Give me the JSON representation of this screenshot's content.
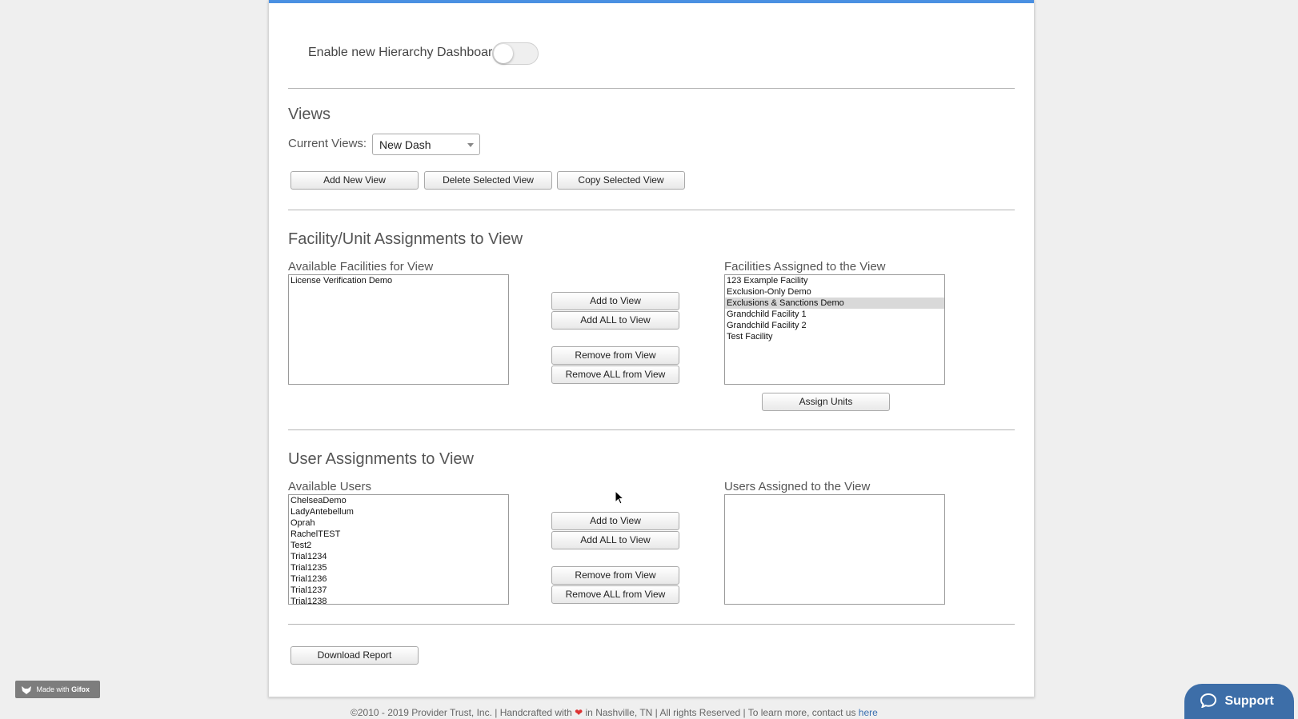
{
  "toggle": {
    "label": "Enable new Hierarchy Dashboard",
    "on": false
  },
  "views": {
    "heading": "Views",
    "current_label": "Current Views:",
    "selected": "New Dash",
    "buttons": {
      "add": "Add New View",
      "delete": "Delete Selected View",
      "copy": "Copy Selected View"
    }
  },
  "facility": {
    "heading": "Facility/Unit Assignments to View",
    "available_label": "Available Facilities for View",
    "assigned_label": "Facilities Assigned to the View",
    "available": [
      "License Verification Demo"
    ],
    "assigned": [
      "123 Example Facility",
      "Exclusion-Only Demo",
      "Exclusions & Sanctions Demo",
      "Grandchild Facility 1",
      "Grandchild Facility 2",
      "Test Facility"
    ],
    "assigned_selected": "Exclusions & Sanctions Demo",
    "buttons": {
      "add": "Add to View",
      "add_all": "Add ALL to View",
      "remove": "Remove from View",
      "remove_all": "Remove ALL from View",
      "assign_units": "Assign Units"
    }
  },
  "users": {
    "heading": "User Assignments to View",
    "available_label": "Available Users",
    "assigned_label": "Users Assigned to the View",
    "available": [
      "ChelseaDemo",
      "LadyAntebellum",
      "Oprah",
      "RachelTEST",
      "Test2",
      "Trial1234",
      "Trial1235",
      "Trial1236",
      "Trial1237",
      "Trial1238"
    ],
    "assigned": [],
    "buttons": {
      "add": "Add to View",
      "add_all": "Add ALL to View",
      "remove": "Remove from View",
      "remove_all": "Remove ALL from View"
    }
  },
  "download_label": "Download Report",
  "gifox": {
    "prefix": "Made with",
    "brand": "Gifox"
  },
  "support_label": "Support",
  "footer": {
    "left": "©2010 - 2019 Provider Trust, Inc.  |  Handcrafted with",
    "right": "in Nashville, TN  |  All rights Reserved  |  To learn more, contact us",
    "link": "here"
  },
  "colors": {
    "accent_bar": "#4a90e2",
    "support_bg": "#3d6ea8",
    "selected_row": "#d9d9d9"
  }
}
